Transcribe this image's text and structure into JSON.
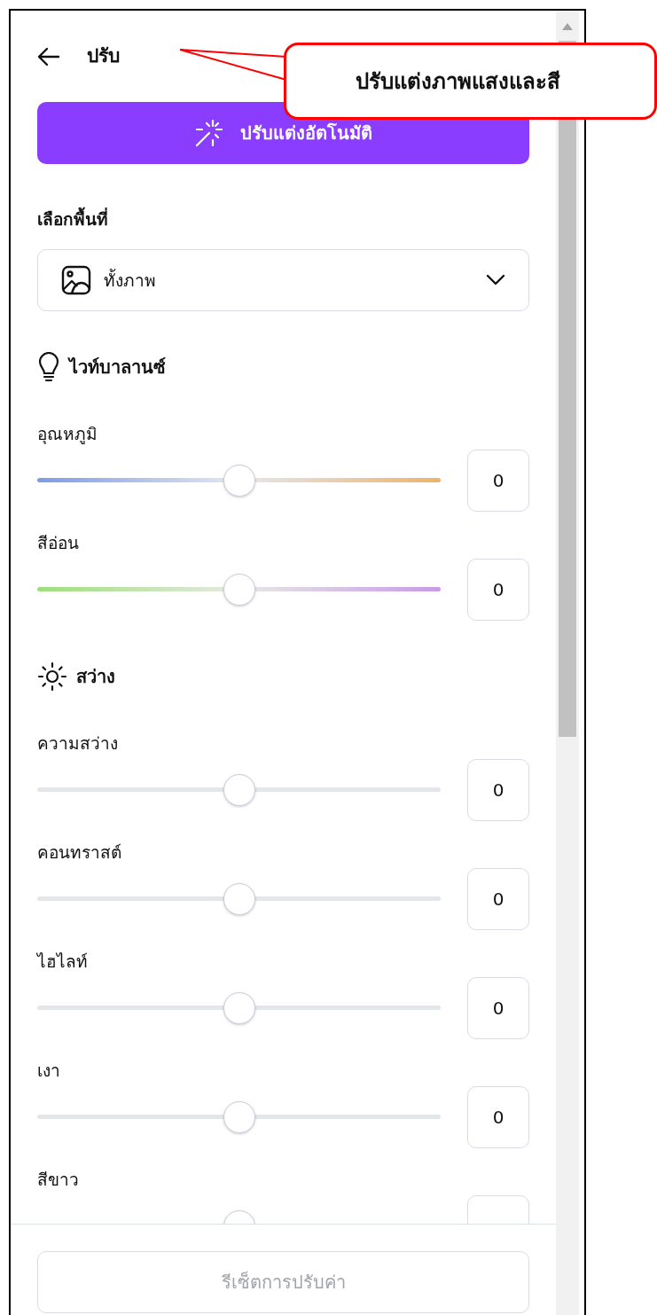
{
  "header": {
    "title": "ปรับ"
  },
  "callout": {
    "text": "ปรับแต่งภาพแสงและสี"
  },
  "auto_button": {
    "label": "ปรับแต่งอัตโนมัติ"
  },
  "area": {
    "label": "เลือกพื้นที่",
    "value": "ทั้งภาพ"
  },
  "sections": [
    {
      "kind": "white_balance",
      "title": "ไวท์บาลานซ์",
      "sliders": [
        {
          "kind": "temperature",
          "label": "อุณหภูมิ",
          "level": 0.5,
          "value": "0"
        },
        {
          "kind": "tint",
          "label": "สีอ่อน",
          "level": 0.5,
          "value": "0"
        }
      ]
    },
    {
      "kind": "light",
      "title": "สว่าง",
      "sliders": [
        {
          "kind": "plain",
          "label": "ความสว่าง",
          "level": 0.5,
          "value": "0"
        },
        {
          "kind": "plain",
          "label": "คอนทราสต์",
          "level": 0.5,
          "value": "0"
        },
        {
          "kind": "plain",
          "label": "ไฮไลท์",
          "level": 0.5,
          "value": "0"
        },
        {
          "kind": "plain",
          "label": "เงา",
          "level": 0.5,
          "value": "0"
        },
        {
          "kind": "plain",
          "label": "สีขาว",
          "level": 0.5
        }
      ]
    }
  ],
  "footer": {
    "reset_label": "รีเซ็ตการปรับค่า",
    "reset_disabled": true
  }
}
